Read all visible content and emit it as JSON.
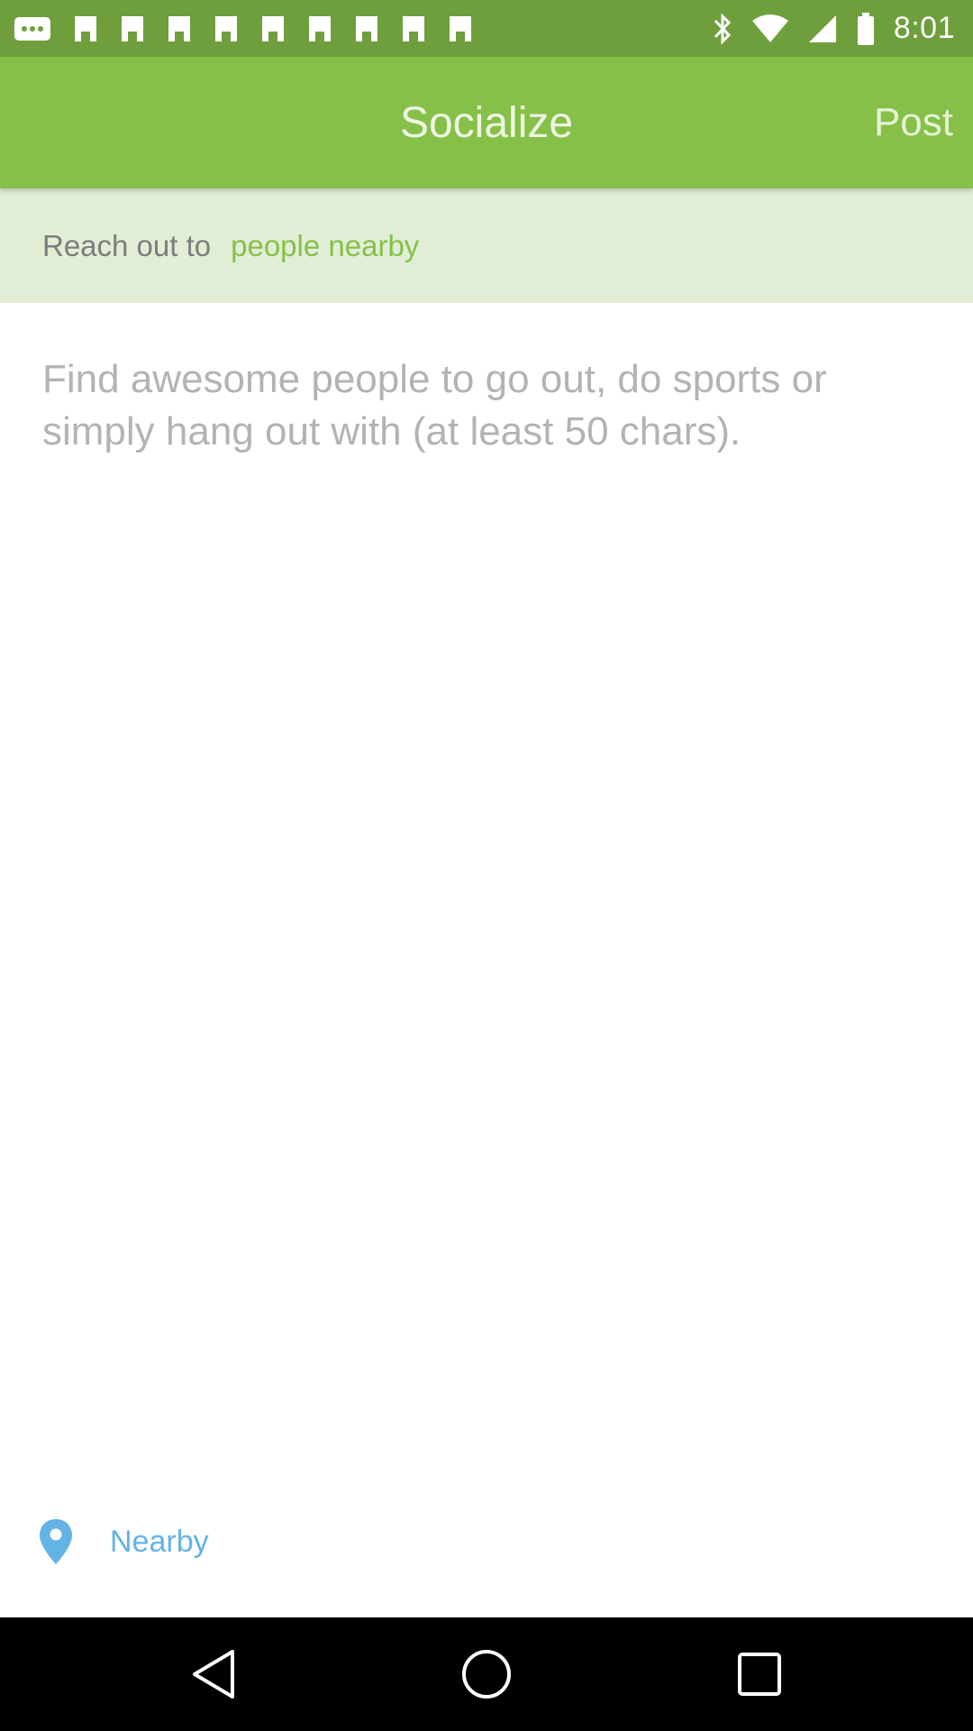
{
  "status_bar": {
    "time": "8:01",
    "icons_left": [
      "more-notifications-icon",
      "notification-icon",
      "notification-icon",
      "notification-icon",
      "notification-icon",
      "notification-icon",
      "notification-icon",
      "notification-icon",
      "notification-icon",
      "notification-icon"
    ],
    "icons_right": [
      "bluetooth-icon",
      "wifi-icon",
      "cellular-signal-icon",
      "battery-icon"
    ]
  },
  "app_bar": {
    "title": "Socialize",
    "post_label": "Post"
  },
  "audience": {
    "prefix": "Reach out to",
    "target": "people nearby"
  },
  "composer": {
    "placeholder": "Find awesome people to go out, do sports or simply hang out with (at least 50 chars).",
    "value": ""
  },
  "location": {
    "icon": "location-pin-icon",
    "label": "Nearby"
  },
  "nav_bar": {
    "buttons": [
      "back-icon",
      "home-icon",
      "recents-icon"
    ]
  },
  "colors": {
    "status_bar": "#6e9f3c",
    "app_bar": "#86c048",
    "audience_bg": "#e1eed5",
    "accent_green": "#86c048",
    "location_blue": "#63b3e6"
  }
}
